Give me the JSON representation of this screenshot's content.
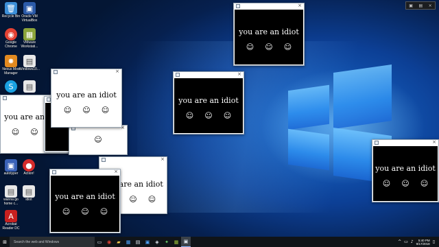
{
  "desktop": {
    "icons": [
      {
        "name": "recycle-bin",
        "label": "Recycle Bin",
        "glyph": "🗑",
        "color": "#3c8fd8"
      },
      {
        "name": "oracle-vm-virtualbox",
        "label": "Oracle VM\nVirtualBox",
        "glyph": "▣",
        "color": "#2b5aa8"
      },
      {
        "name": "google-chrome",
        "label": "Google\nChrome",
        "glyph": "◉",
        "color": "#e34133"
      },
      {
        "name": "vmware-workstation",
        "label": "VMware\nWorkstati...",
        "glyph": "▦",
        "color": "#8aa33a"
      },
      {
        "name": "nexus-mod-manager",
        "label": "Nexus Mod\nManager",
        "glyph": "✸",
        "color": "#e28a20"
      },
      {
        "name": "windows10-file",
        "label": "Windows10...",
        "glyph": "▤",
        "color": "#e8e8e8"
      },
      {
        "name": "skype",
        "label": "",
        "glyph": "S",
        "color": "#1aa1e1"
      },
      {
        "name": "document-file",
        "label": "",
        "glyph": "▤",
        "color": "#e8e8e8"
      },
      {
        "name": "autotyper",
        "label": "autotyper",
        "glyph": "▣",
        "color": "#3a62b8"
      },
      {
        "name": "action",
        "label": "Action!",
        "glyph": "●",
        "color": "#d52b2b"
      },
      {
        "name": "wanna-go-home",
        "label": "wanna go\nhome c...",
        "glyph": "▤",
        "color": "#e8e8e8"
      },
      {
        "name": "idiot",
        "label": "idiot",
        "glyph": "▤",
        "color": "#e8e8e8"
      },
      {
        "name": "acrobat-reader-dc",
        "label": "Acrobat\nReader DC",
        "glyph": "A",
        "color": "#c8201f"
      }
    ]
  },
  "popup": {
    "message": "you are an idiot",
    "face": "☺",
    "close": "×"
  },
  "taskbar": {
    "search_placeholder": "Search the web and Windows",
    "time": "5:40 PM",
    "date": "9/17/2018",
    "apps": [
      "task-view",
      "chrome",
      "file-explorer",
      "store",
      "calculator",
      "photos",
      "media",
      "games",
      "vmware",
      "idiot"
    ]
  },
  "colors": {
    "wallpaper_dark": "#06204f",
    "wallpaper_light": "#6fc4ff",
    "taskbar": "#101418"
  }
}
